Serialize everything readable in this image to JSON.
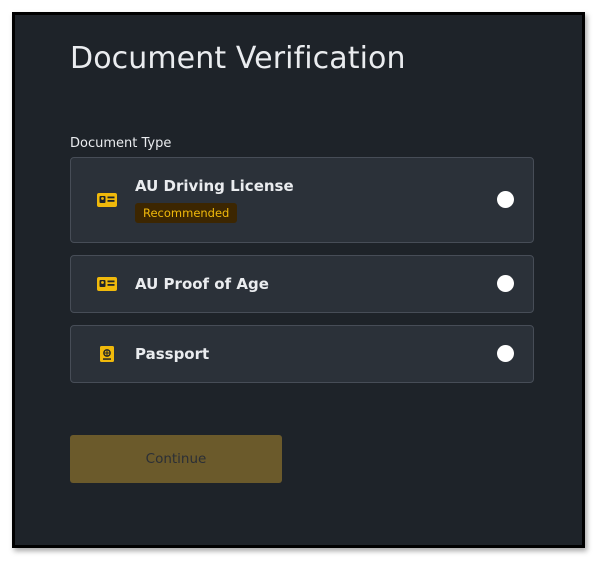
{
  "page": {
    "title": "Document Verification",
    "section_label": "Document Type"
  },
  "options": [
    {
      "label": "AU Driving License",
      "badge": "Recommended",
      "icon": "id-card-icon",
      "selected": false
    },
    {
      "label": "AU Proof of Age",
      "icon": "id-card-icon",
      "selected": false
    },
    {
      "label": "Passport",
      "icon": "passport-icon",
      "selected": false
    }
  ],
  "actions": {
    "continue_label": "Continue"
  },
  "colors": {
    "background": "#1e2329",
    "card": "#2b3139",
    "card_border": "#474d57",
    "accent": "#f0b90b",
    "badge_bg": "#3c2601",
    "button_disabled": "#6b5a2b",
    "text": "#eaecef"
  }
}
